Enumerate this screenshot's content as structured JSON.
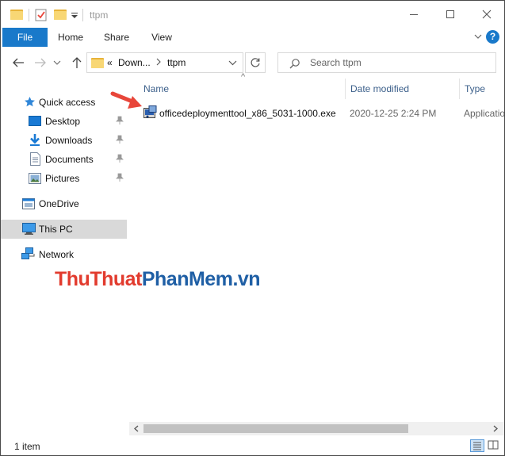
{
  "titlebar": {
    "title": "ttpm",
    "minimize": "—",
    "maximize": "☐",
    "close": "✕"
  },
  "ribbon": {
    "tabs": [
      {
        "label": "File"
      },
      {
        "label": "Home"
      },
      {
        "label": "Share"
      },
      {
        "label": "View"
      }
    ],
    "expand": "⌄",
    "help": "?"
  },
  "nav": {
    "back": "←",
    "forward": "→",
    "recent": "⌄",
    "up": "↑",
    "address": {
      "prefix": "«",
      "segments": [
        "Down...",
        "ttpm"
      ],
      "dropdown": "⌄"
    },
    "refresh": "↻",
    "search_placeholder": "Search ttpm"
  },
  "sidebar": {
    "items": [
      {
        "label": "Quick access"
      },
      {
        "label": "Desktop"
      },
      {
        "label": "Downloads"
      },
      {
        "label": "Documents"
      },
      {
        "label": "Pictures"
      },
      {
        "label": "OneDrive"
      },
      {
        "label": "This PC"
      },
      {
        "label": "Network"
      }
    ]
  },
  "content": {
    "columns": [
      {
        "label": "Name"
      },
      {
        "label": "Date modified"
      },
      {
        "label": "Type"
      }
    ],
    "sort_indicator": "^",
    "files": [
      {
        "name": "officedeploymenttool_x86_5031-1000.exe",
        "date": "2020-12-25 2:24 PM",
        "type": "Application"
      }
    ]
  },
  "watermark": {
    "part1": "ThuThuat",
    "part2": "PhanMem",
    "part3": ".vn"
  },
  "colors": {
    "accent": "#1979ca",
    "arrow": "#e8463a",
    "watermark_red": "#e23b2e",
    "watermark_blue": "#1f5fa5"
  },
  "scroll": {
    "left": "<",
    "right": ">"
  },
  "status": {
    "count": "1 item"
  }
}
